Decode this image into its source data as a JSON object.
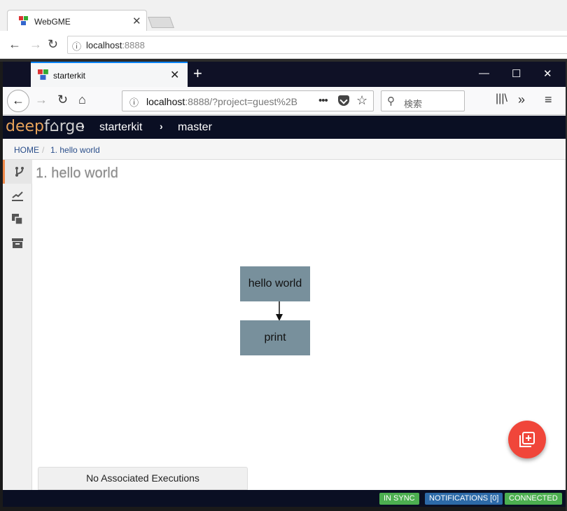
{
  "outer_browser": {
    "tab_title": "WebGME",
    "url_host": "localhost",
    "url_port": ":8888"
  },
  "inner_browser": {
    "tab_title": "starterkit",
    "url_host": "localhost",
    "url_rest": ":8888/?project=guest%2B",
    "search_placeholder": "検索"
  },
  "app": {
    "logo_deep": "deep",
    "logo_forge": "f⌂rge",
    "project": "starterkit",
    "branch": "master"
  },
  "breadcrumb": {
    "home": "HOME",
    "separator": "/",
    "current": "1. hello world"
  },
  "sidebar": {
    "items": [
      {
        "icon": "fork-icon",
        "active": true
      },
      {
        "icon": "line-chart-icon",
        "active": false
      },
      {
        "icon": "clone-icon",
        "active": false
      },
      {
        "icon": "archive-icon",
        "active": false
      }
    ]
  },
  "main": {
    "title": "1. hello world",
    "nodes": [
      {
        "label": "hello world"
      },
      {
        "label": "print"
      }
    ],
    "executions_label": "No Associated Executions",
    "fab_icon": "add-to-queue-icon"
  },
  "footer": {
    "sync": "IN SYNC",
    "notifications": "NOTIFICATIONS [0]",
    "connected": "CONNECTED"
  },
  "colors": {
    "accent_orange": "#f08a4b",
    "node_fill": "#78909c",
    "fab_red": "#f0463a",
    "header_bg": "#0a0f23",
    "status_green": "#4caf50",
    "status_blue": "#2d6aa8"
  }
}
